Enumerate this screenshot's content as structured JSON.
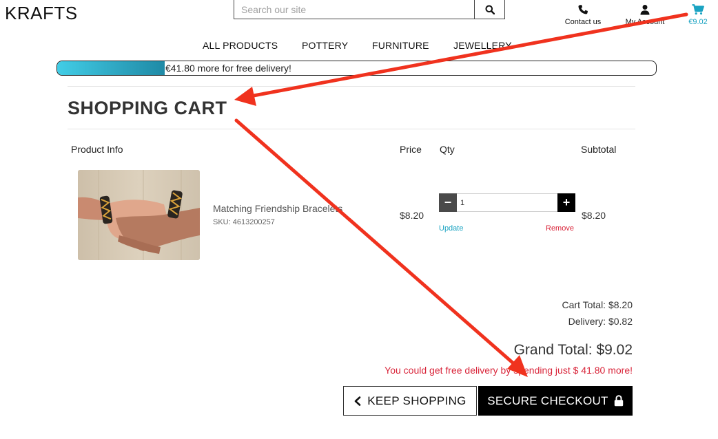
{
  "brand": {
    "logo_text": "KRAFTS"
  },
  "search": {
    "placeholder": "Search our site"
  },
  "utility": {
    "contact_label": "Contact us",
    "account_label": "My Account",
    "cart_amount": "€9.02"
  },
  "nav": {
    "items": [
      "ALL PRODUCTS",
      "POTTERY",
      "FURNITURE",
      "JEWELLERY"
    ]
  },
  "delivery_progress": {
    "text": "€41.80 more for free delivery!",
    "fill_fraction": 0.18
  },
  "page": {
    "title": "SHOPPING CART"
  },
  "table": {
    "headers": [
      "Product Info",
      "Price",
      "Qty",
      "Subtotal"
    ]
  },
  "cart_item": {
    "image_alt": "Matching Friendship Bracelets",
    "name": "Matching Friendship Bracelets",
    "sku": "SKU: 4613200257",
    "price": "$8.20",
    "quantity": "1",
    "update_label": "Update",
    "remove_label": "Remove",
    "subtotal": "$8.20"
  },
  "totals": {
    "cart_total": "Cart Total: $8.20",
    "delivery": "Delivery: $0.82",
    "grand_total": "Grand Total: $9.02",
    "free_delivery_msg": "You could get free delivery by spending just $ 41.80 more!"
  },
  "actions": {
    "keep_shopping": "KEEP SHOPPING",
    "secure_checkout": "SECURE CHECKOUT"
  },
  "colors": {
    "accent": "#1aa3c2",
    "alert": "#d9253a",
    "annotation_arrow": "#f0321e"
  },
  "icons": {
    "search": "search-icon",
    "phone": "phone-icon",
    "user": "user-icon",
    "cart": "cart-icon",
    "back": "chevron-left-icon",
    "lock": "lock-icon"
  }
}
